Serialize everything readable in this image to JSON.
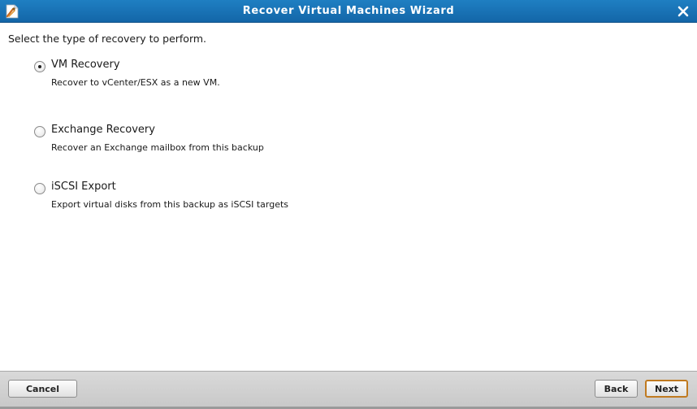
{
  "window": {
    "title": "Recover Virtual Machines Wizard",
    "app_icon": "document-wizard-icon",
    "close_icon": "close-icon"
  },
  "prompt": "Select the type of recovery to perform.",
  "options": [
    {
      "label": "VM Recovery",
      "description": "Recover to vCenter/ESX as a new VM.",
      "selected": true
    },
    {
      "label": "Exchange Recovery",
      "description": "Recover an Exchange mailbox from this backup",
      "selected": false
    },
    {
      "label": "iSCSI Export",
      "description": "Export virtual disks from this backup as iSCSI targets",
      "selected": false
    }
  ],
  "footer": {
    "cancel_label": "Cancel",
    "back_label": "Back",
    "next_label": "Next"
  },
  "colors": {
    "titlebar": "#1a72b8",
    "next_focus_border": "#c07a20"
  }
}
